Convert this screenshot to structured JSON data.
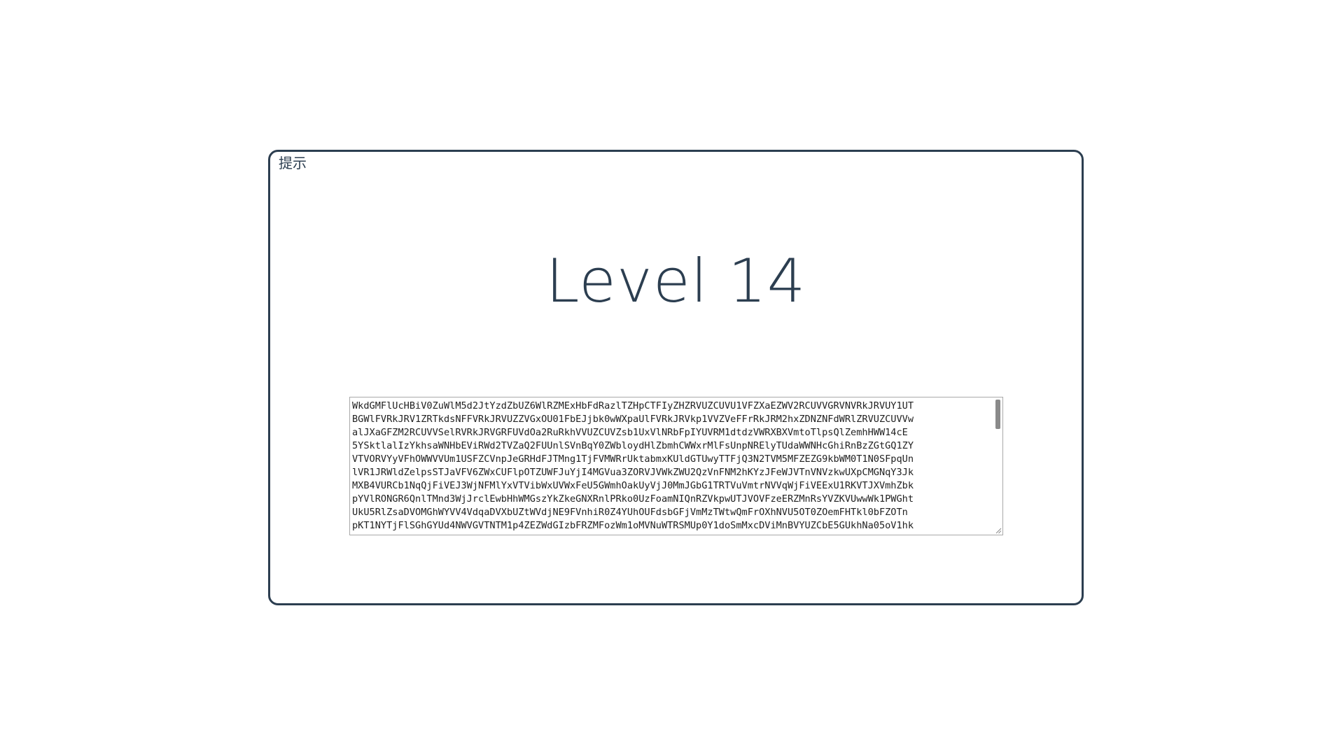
{
  "panel": {
    "hint_label": "提示",
    "title": "Level 14"
  },
  "code_area": {
    "value": "WkdGMFlUcHBiV0ZuWlM5d2JtYzdZbUZ6WlRZMExHbFdRazlTZHpCTFIyZHZRVUZCUVU1VFZXaEZWV2RCUVVGRVNVRkJRVUY1UT\nBGWlFVRkJRV1ZRTkdsNFFVRkJRVUZZVGxOU01FbEJjbk0wWXpaUlFVRkJRVkp1VVZVeFFrRkJRM2hxZDNZNFdWRlZRVUZCUVVw\nalJXaGFZM2RCUVVSelRVRkJRVGRFUVdOa2RuRkhVVUZCUVZsb1UxVlNRbFpIYUVRM1dtdzVWRXBXVmtoTlpsQlZemhHWW14cE\n5YSktlalIzYkhsaWNHbEViRWd2TVZaQ2FUUnlSVnBqY0ZWbloydHlZbmhCWWxrMlFsUnpNRElyTUdaWWNHcGhiRnBzZGtGQ1ZY\nVTVORVYyVFhOWWVVUm1USFZCVnpJeGRHdFJTMng1TjFVMWRrUktabmxKUldGTUwyTTFjQ3N2TVM5MFZEZG9kbWM0T1N0SFpqUn\nlVR1JRWldZelpsSTJaVFV6ZWxCUFlpOTZUWFJuYjI4MGVua3ZORVJVWkZWU2QzVnFNM2hKYzJFeWJVTnVNVzkwUXpCMGNqY3Jk\nMXB4VURCb1NqQjFiVEJ3WjNFMlYxVTVibWxUVWxFeU5GWmhOakUyVjJ0MmJGbG1TRTVuVmtrNVVqWjFiVEExU1RKVTJXVmhZbk\npYVlRONGR6QnlTMnd3WjJrclEwbHhWMGszYkZkeGNXRnlPRko0UzFoamNIQnRZVkpwUTJVOVFzeERZMnRsYVZKVUwwWk1PWGht\nUkU5RlZsaDVOMGhWYVV4VdqaDVXbUZtWVdjNE9FVnhiR0Z4YUhOUFdsbGFjVmMzTWtwQmFrOXhNVU5OT0ZOemFHTkl0bFZOTn\npKT1NYTjFlSGhGYUd4NWVGVTNTM1p4ZEZWdGIzbFRZMFozWm1oMVNuWTRSMUp0Y1doSmMxcDViMnBVYUZCbE5GUkhNa05oV1hk"
  }
}
